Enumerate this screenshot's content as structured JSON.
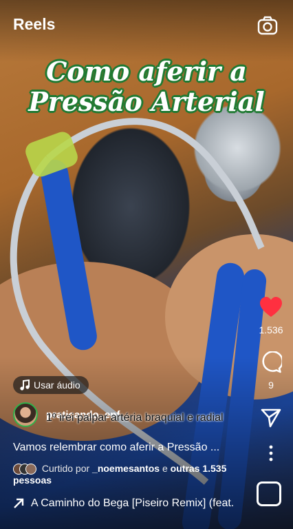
{
  "header": {
    "title": "Reels",
    "camera_icon": "camera-icon"
  },
  "video": {
    "headline_line1": "Como aferir a",
    "headline_line2": "Pressão Arterial",
    "caption_overlay": "1º irei palpar artéria braquial e radial",
    "headline_color": "#1f7a32"
  },
  "actions": {
    "like": {
      "icon": "heart-icon",
      "count": "1.536",
      "color": "#ff3040"
    },
    "comment": {
      "icon": "comment-icon",
      "count": "9"
    },
    "share": {
      "icon": "send-icon"
    },
    "more": {
      "icon": "more-vertical-icon"
    }
  },
  "audio_chip": {
    "label": "Usar áudio",
    "icon": "music-note-icon"
  },
  "author": {
    "username": "praticando_enf"
  },
  "post": {
    "description": "Vamos relembrar como aferir a Pressão ...",
    "liked_prefix": "Curtido por",
    "liked_user": "_noemesantos",
    "liked_and": "e",
    "liked_others": "outras 1.535 pessoas"
  },
  "music": {
    "title": "A Caminho do Bega [Piseiro Remix] (feat.",
    "icon": "arrow-up-right-icon"
  }
}
